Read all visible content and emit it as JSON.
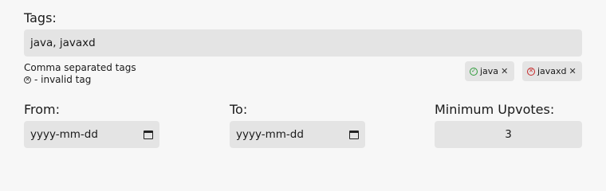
{
  "tags": {
    "label": "Tags:",
    "value": "java, javaxd",
    "help_line1": "Comma separated tags",
    "help_line2": "- invalid tag",
    "chips": [
      {
        "text": "java",
        "valid": true
      },
      {
        "text": "javaxd",
        "valid": false
      }
    ]
  },
  "from": {
    "label": "From:",
    "placeholder": "yyyy-mm-dd"
  },
  "to": {
    "label": "To:",
    "placeholder": "yyyy-mm-dd"
  },
  "upvotes": {
    "label": "Minimum Upvotes:",
    "value": "3"
  },
  "colors": {
    "valid": "#2e9b3a",
    "invalid": "#c62828",
    "input_bg": "#e4e4e4"
  },
  "icons": {
    "valid": "check-circle-icon",
    "invalid": "x-circle-icon",
    "remove": "close-icon",
    "calendar": "calendar-icon"
  }
}
